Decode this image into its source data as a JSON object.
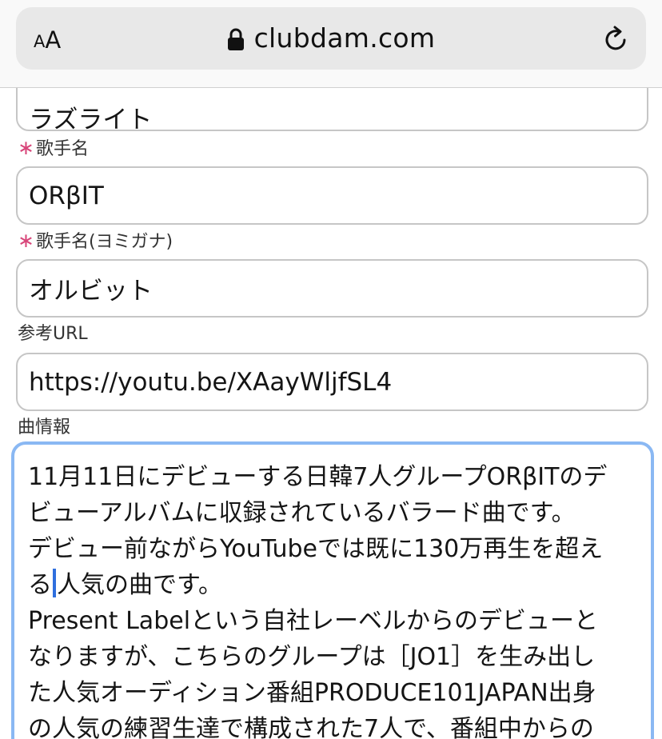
{
  "browser": {
    "text_size_label_small": "A",
    "text_size_label_big": "A",
    "domain": "clubdam.com",
    "icons": {
      "lock": "lock-icon",
      "reload": "reload-icon"
    }
  },
  "form": {
    "song_title": {
      "value": "ラズライト"
    },
    "artist": {
      "required_mark": "∗",
      "label": "歌手名",
      "value": "ORβIT"
    },
    "artist_reading": {
      "required_mark": "∗",
      "label": "歌手名(ヨミガナ)",
      "value": "オルビット"
    },
    "reference_url": {
      "label": "参考URL",
      "value": "https://youtu.be/XAayWljfSL4"
    },
    "song_info": {
      "label": "曲情報",
      "lines": [
        "11月11日にデビューする日韓7人グループORβITのデ",
        "ビューアルバムに収録されているバラード曲です。",
        "デビュー前ながらYouTubeでは既に130万再生を超え",
        "る",
        "人気の曲です。",
        "Present Labelという自社レーベルからのデビューと",
        "なりますが、こちらのグループは［JO1］を生み出し",
        "た人気オーディション番組PRODUCE101JAPAN出身",
        "の人気の練習生達で構成された7人で、番組中からの"
      ]
    }
  },
  "colors": {
    "required": "#d8467a",
    "focus_border": "#8ab8f3",
    "caret": "#2f6fde",
    "field_border": "#c6c6c6"
  }
}
